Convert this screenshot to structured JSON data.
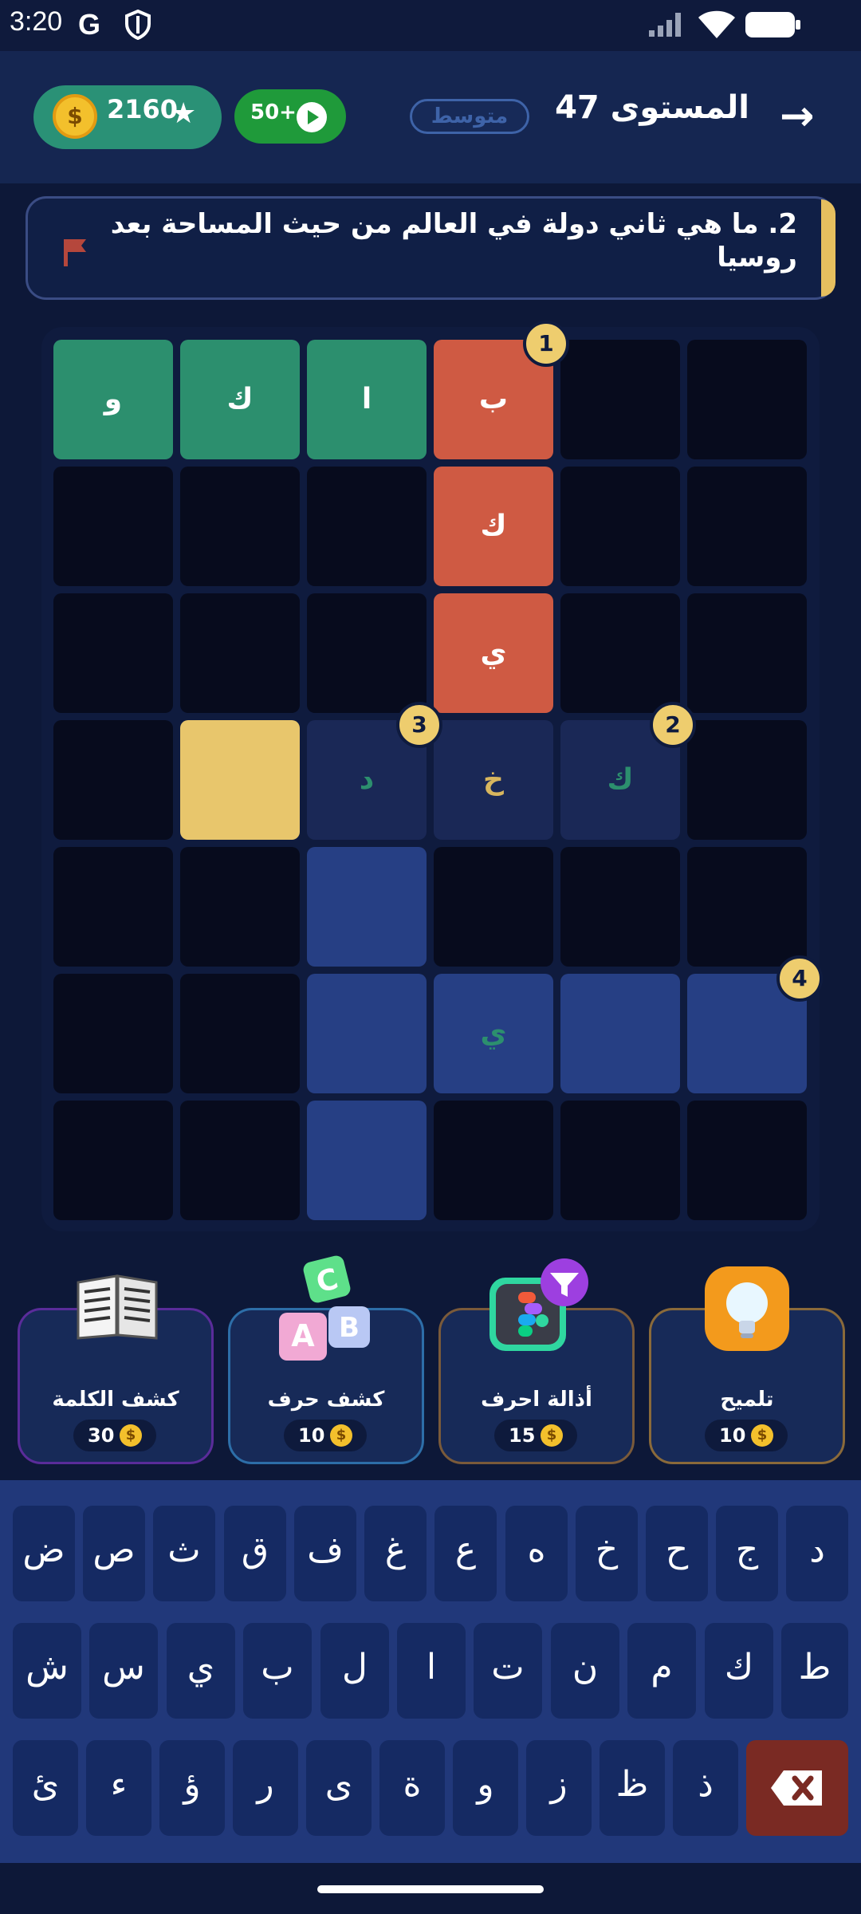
{
  "status_bar": {
    "time": "3:20",
    "g_icon": "G"
  },
  "header": {
    "coins": "2160",
    "coin_symbol": "$",
    "video_reward": "50+",
    "difficulty": "متوسط",
    "level_title": "المستوى 47",
    "back_icon": "arrow-right-icon"
  },
  "question": {
    "text": "2. ما هي ثاني دولة في العالم من حيث المساحة بعد روسيا"
  },
  "board": {
    "cells": {
      "r0c0": "و",
      "r0c1": "ك",
      "r0c2": "ا",
      "r0c3": "ب",
      "r1c3": "ك",
      "r2c3": "ي",
      "r3c2": "د",
      "r3c3": "خ",
      "r3c4": "ك",
      "r5c3": "ي"
    },
    "badges": [
      "1",
      "2",
      "3",
      "4"
    ]
  },
  "powerups": [
    {
      "label": "كشف الكلمة",
      "cost": "30",
      "icon": "book-icon"
    },
    {
      "label": "كشف حرف",
      "cost": "10",
      "icon": "letter-blocks-icon"
    },
    {
      "label": "أذالة احرف",
      "cost": "15",
      "icon": "filter-icon"
    },
    {
      "label": "تلميح",
      "cost": "10",
      "icon": "lightbulb-icon"
    }
  ],
  "keyboard": {
    "row1": [
      "ض",
      "ص",
      "ث",
      "ق",
      "ف",
      "غ",
      "ع",
      "ه",
      "خ",
      "ح",
      "ج",
      "د"
    ],
    "row2": [
      "ش",
      "س",
      "ي",
      "ب",
      "ل",
      "ا",
      "ت",
      "ن",
      "م",
      "ك",
      "ط"
    ],
    "row3": [
      "ئ",
      "ء",
      "ؤ",
      "ر",
      "ى",
      "ة",
      "و",
      "ز",
      "ظ",
      "ذ"
    ],
    "backspace_icon": "backspace-icon"
  },
  "colors": {
    "background": "#0d1838",
    "green": "#2c8f6e",
    "red": "#cf5a43",
    "yellow": "#e8c66c",
    "keyboard": "#21387a"
  }
}
